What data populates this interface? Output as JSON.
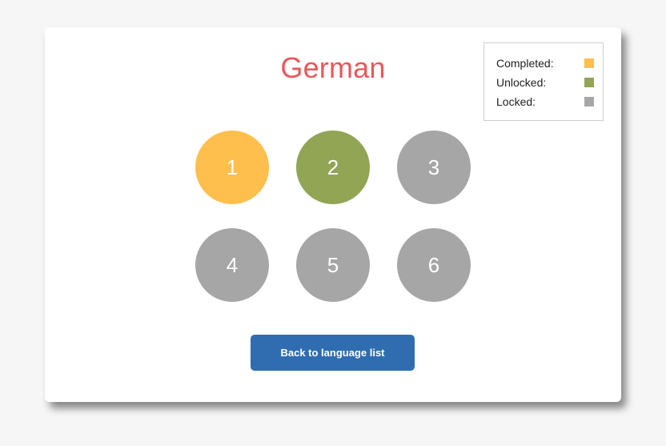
{
  "title": "German",
  "colors": {
    "completed": "#ffbf4d",
    "unlocked": "#91a555",
    "locked": "#a6a6a6",
    "title": "#e8585a",
    "button": "#2f6db0"
  },
  "legend": {
    "items": [
      {
        "label": "Completed:",
        "status": "completed"
      },
      {
        "label": "Unlocked:",
        "status": "unlocked"
      },
      {
        "label": "Locked:",
        "status": "locked"
      }
    ]
  },
  "levels": [
    {
      "label": "1",
      "status": "completed"
    },
    {
      "label": "2",
      "status": "unlocked"
    },
    {
      "label": "3",
      "status": "locked"
    },
    {
      "label": "4",
      "status": "locked"
    },
    {
      "label": "5",
      "status": "locked"
    },
    {
      "label": "6",
      "status": "locked"
    }
  ],
  "back_button": {
    "label": "Back to language list"
  }
}
